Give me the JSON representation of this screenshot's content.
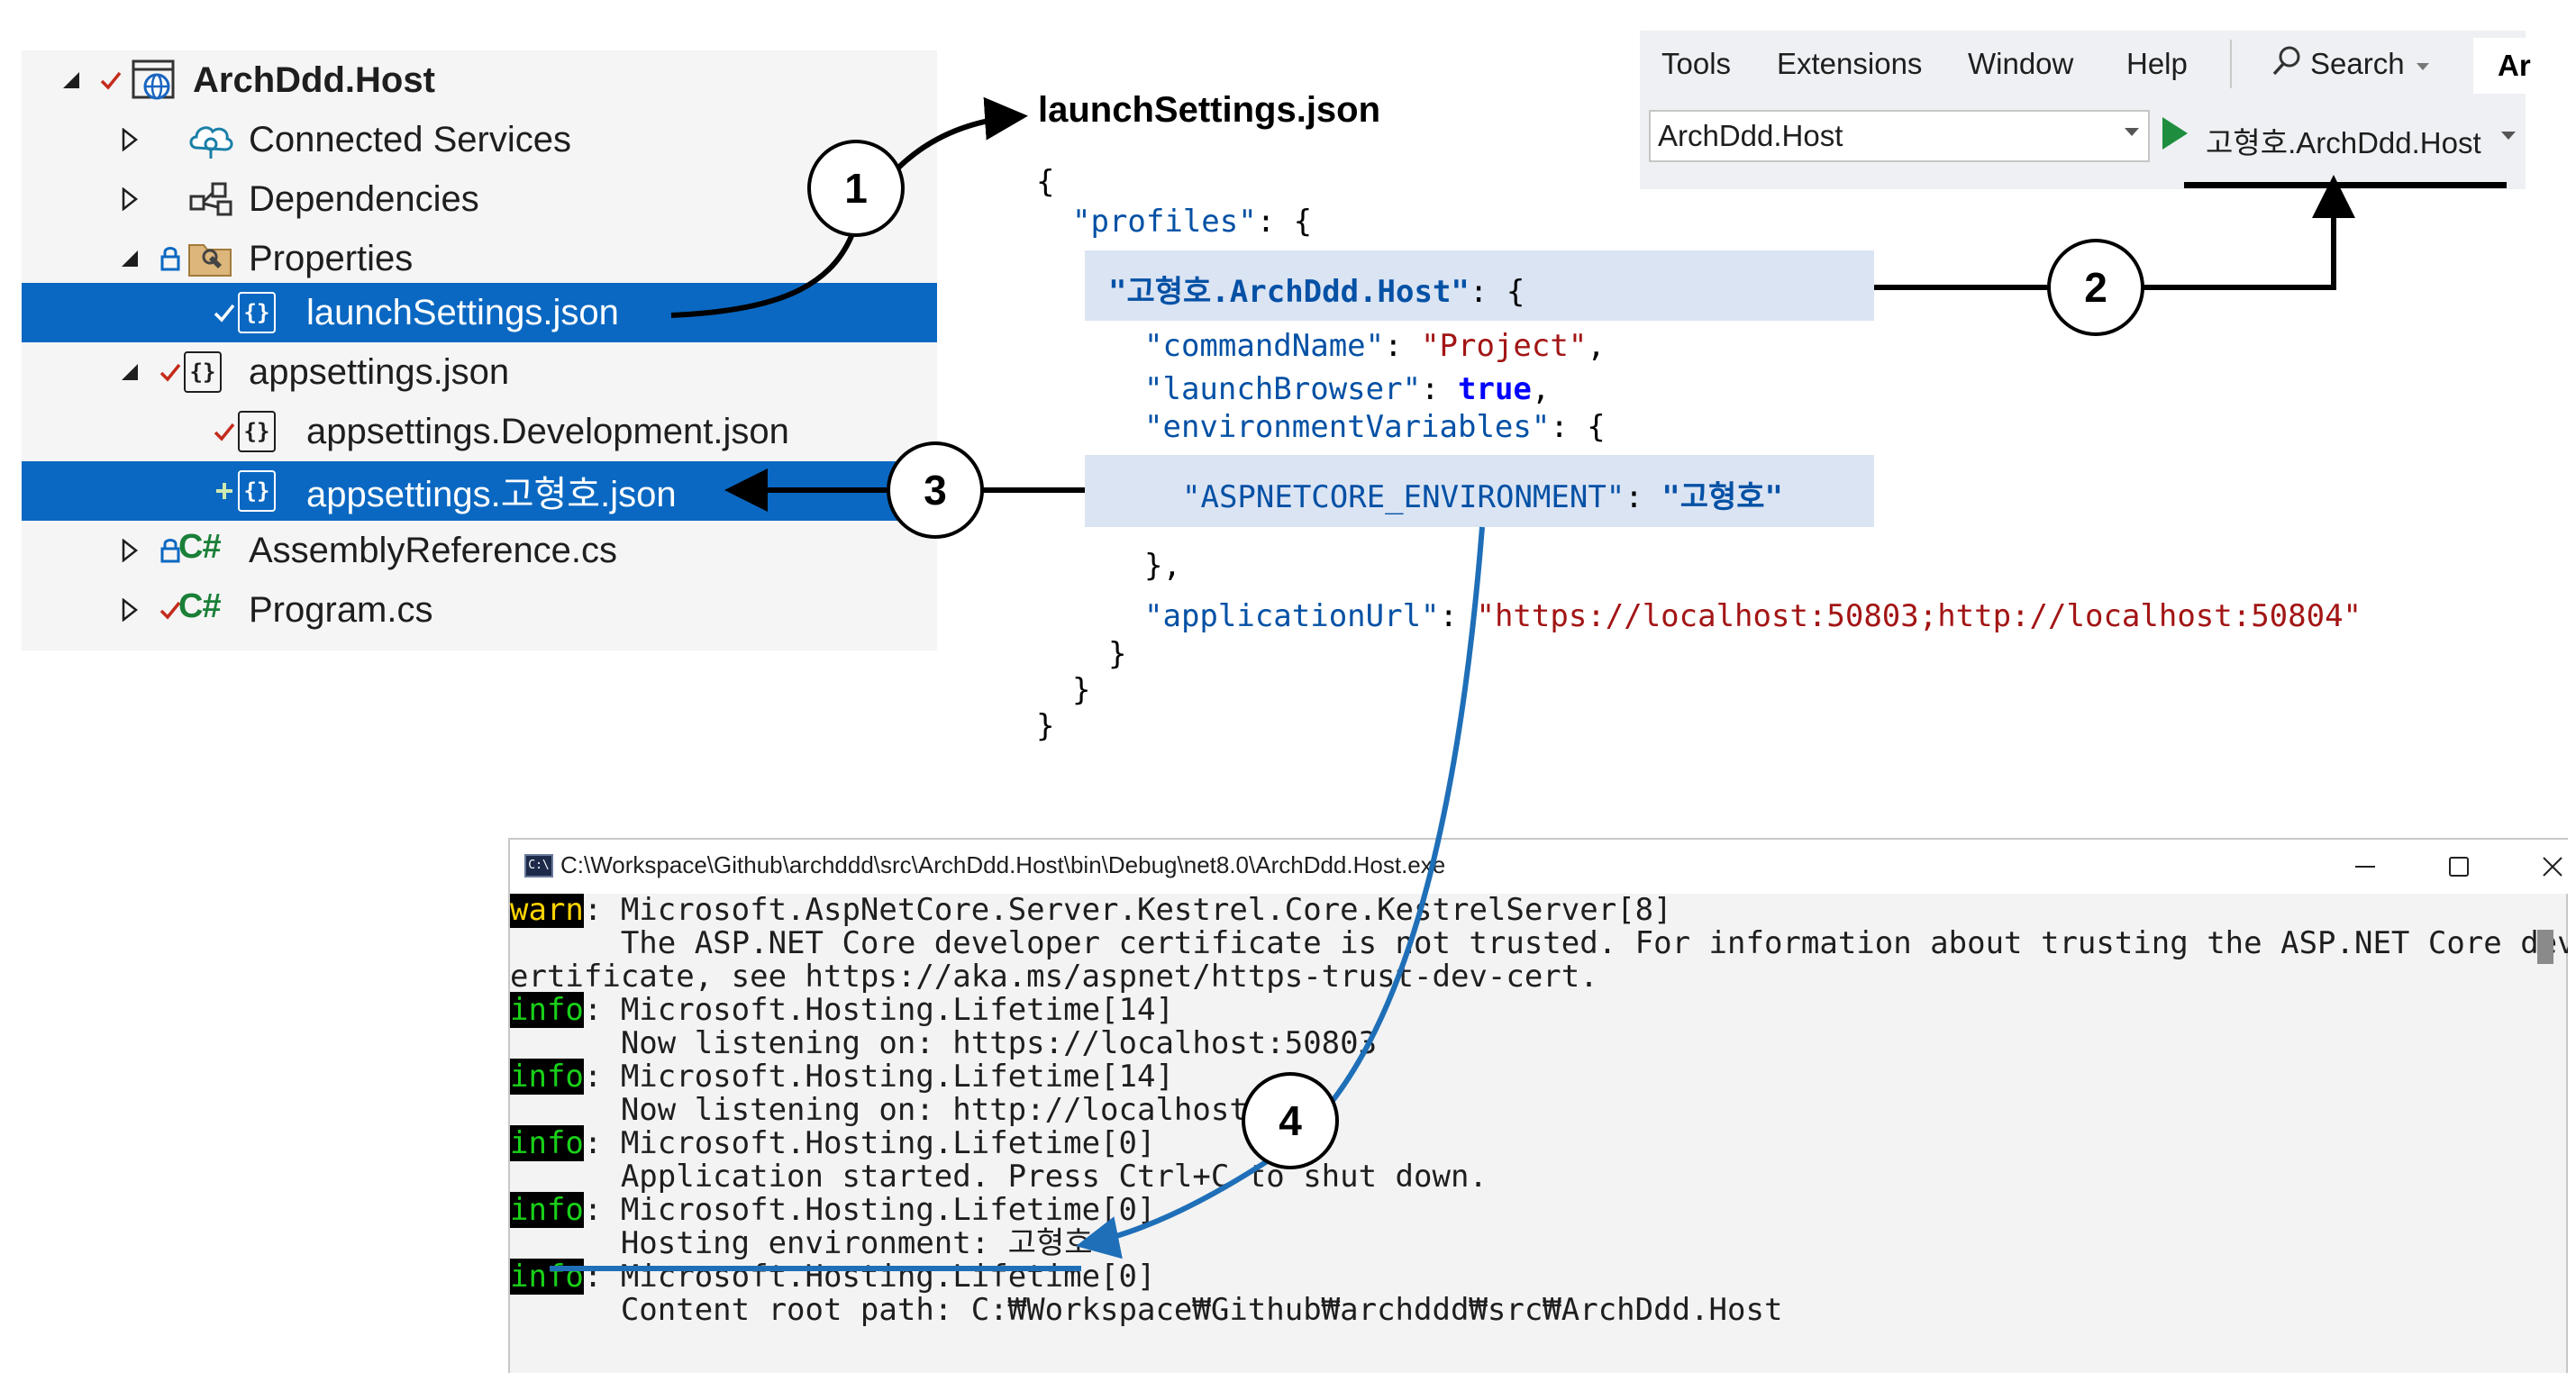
{
  "solution_explorer": {
    "items": [
      {
        "label": "ArchDdd.Host",
        "icon": "web-project-icon",
        "status": "check",
        "expander": "expanded",
        "bold": true,
        "selected": false
      },
      {
        "label": "Connected Services",
        "icon": "connected-services-icon",
        "status": "",
        "expander": "collapsed",
        "bold": false,
        "selected": false
      },
      {
        "label": "Dependencies",
        "icon": "dependencies-icon",
        "status": "",
        "expander": "collapsed",
        "bold": false,
        "selected": false
      },
      {
        "label": "Properties",
        "icon": "properties-folder-icon",
        "status": "lock",
        "expander": "expanded",
        "bold": false,
        "selected": false
      },
      {
        "label": "launchSettings.json",
        "icon": "json-file-icon",
        "status": "check",
        "expander": "",
        "bold": false,
        "selected": true
      },
      {
        "label": "appsettings.json",
        "icon": "json-file-icon",
        "status": "check",
        "expander": "expanded",
        "bold": false,
        "selected": false
      },
      {
        "label": "appsettings.Development.json",
        "icon": "json-file-icon",
        "status": "check",
        "expander": "",
        "bold": false,
        "selected": false
      },
      {
        "label": "appsettings.고형호.json",
        "icon": "json-file-icon",
        "status": "plus",
        "expander": "",
        "bold": false,
        "selected": true
      },
      {
        "label": "AssemblyReference.cs",
        "icon": "csharp-file-icon",
        "status": "lock",
        "expander": "collapsed",
        "bold": false,
        "selected": false
      },
      {
        "label": "Program.cs",
        "icon": "csharp-file-icon",
        "status": "check",
        "expander": "collapsed",
        "bold": false,
        "selected": false
      }
    ],
    "json_glyph": "{}",
    "csharp_glyph": "C#"
  },
  "code": {
    "title": "launchSettings.json",
    "open_brace": "{",
    "profiles_key": "\"profiles\"",
    "colon_brace": ": {",
    "profile_key": "\"고형호.ArchDdd.Host\"",
    "command_name_key": "\"commandName\"",
    "command_name_value": "\"Project\"",
    "launch_browser_key": "\"launchBrowser\"",
    "launch_browser_value": "true",
    "env_vars_key": "\"environmentVariables\"",
    "aspnet_env_key": "\"ASPNETCORE_ENVIRONMENT\"",
    "aspnet_env_value": "\"고형호\"",
    "close_brace_comma": "},",
    "app_url_key": "\"applicationUrl\"",
    "app_url_value": "\"https://localhost:50803;http://localhost:50804\"",
    "close_brace": "}",
    "colon": ": ",
    "comma": ","
  },
  "toolbar": {
    "menu": [
      "Tools",
      "Extensions",
      "Window",
      "Help"
    ],
    "search_label": "Search",
    "edge_text": "Ar",
    "project_combo_value": "ArchDdd.Host",
    "run_profile": "고형호.ArchDdd.Host"
  },
  "console": {
    "title": "C:\\Workspace\\Github\\archddd\\src\\ArchDdd.Host\\bin\\Debug\\net8.0\\ArchDdd.Host.exe",
    "icon_text": "C:\\",
    "lines": [
      {
        "tag": "warn",
        "text": ": Microsoft.AspNetCore.Server.Kestrel.Core.KestrelServer[8]"
      },
      {
        "tag": "",
        "text": "      The ASP.NET Core developer certificate is not trusted. For information about trusting the ASP.NET Core developer c"
      },
      {
        "tag": "",
        "text": "ertificate, see https://aka.ms/aspnet/https-trust-dev-cert."
      },
      {
        "tag": "info",
        "text": ": Microsoft.Hosting.Lifetime[14]"
      },
      {
        "tag": "",
        "text": "      Now listening on: https://localhost:50803"
      },
      {
        "tag": "info",
        "text": ": Microsoft.Hosting.Lifetime[14]"
      },
      {
        "tag": "",
        "text": "      Now listening on: http://localhost:508"
      },
      {
        "tag": "info",
        "text": ": Microsoft.Hosting.Lifetime[0]"
      },
      {
        "tag": "",
        "text": "      Application started. Press Ctrl+C to shut down."
      },
      {
        "tag": "info",
        "text": ": Microsoft.Hosting.Lifetime[0]"
      },
      {
        "tag": "",
        "text": "      Hosting environment: 고형호"
      },
      {
        "tag": "info",
        "text": ": Microsoft.Hosting.Lifetime[0]"
      },
      {
        "tag": "",
        "text": "      Content root path: C:₩Workspace₩Github₩archddd₩src₩ArchDdd.Host"
      }
    ]
  },
  "callouts": [
    "1",
    "2",
    "3",
    "4"
  ],
  "colors": {
    "selection": "#0a68c2",
    "json_key": "#0451a5",
    "json_string": "#a31515",
    "json_keyword": "#0000ff",
    "highlight": "#dbe4f3",
    "info_tag": "#19d119",
    "warn_tag": "#ffd400",
    "annotation_blue": "#1f6fb8"
  }
}
